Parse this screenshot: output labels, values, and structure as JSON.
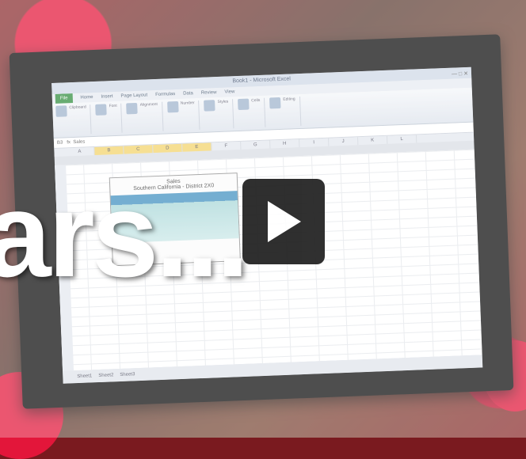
{
  "window": {
    "title": "Book1 - Microsoft Excel",
    "controls": "— □ ✕"
  },
  "ribbon": {
    "tabs": [
      "File",
      "Home",
      "Insert",
      "Page Layout",
      "Formulas",
      "Data",
      "Review",
      "View"
    ],
    "groups": [
      "Clipboard",
      "Font",
      "Alignment",
      "Number",
      "Styles",
      "Cells",
      "Editing"
    ]
  },
  "formula_bar": {
    "name_box": "B3",
    "content": "Sales"
  },
  "columns": [
    "A",
    "B",
    "C",
    "D",
    "E",
    "F",
    "G",
    "H",
    "I",
    "J",
    "K",
    "L"
  ],
  "sales_box": {
    "title": "Sales",
    "subtitle": "Southern California - District 2X0"
  },
  "sheet_tabs": [
    "Sheet1",
    "Sheet2",
    "Sheet3"
  ],
  "overlay_text": "ars...",
  "colors": {
    "accent": "#e3163a",
    "excel_green": "#2f8c3c",
    "table_header": "#3f8fbf"
  },
  "icons": {
    "play": "play-icon"
  }
}
